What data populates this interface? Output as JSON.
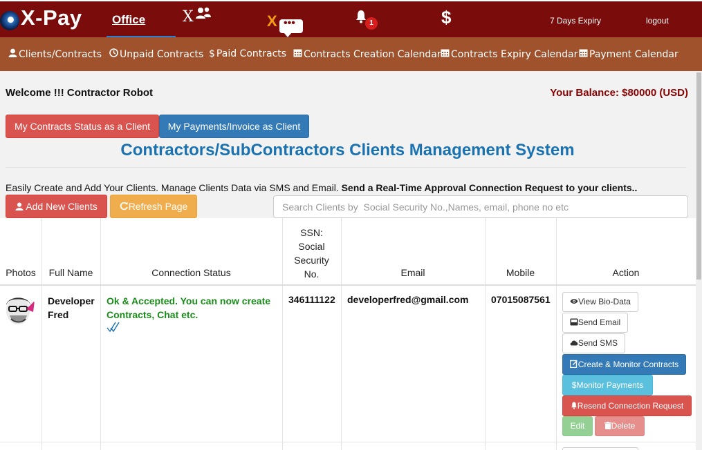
{
  "nav": {
    "logo": "X-Pay",
    "office": "Office",
    "users_x": "X",
    "chat_x": "X",
    "chat_glyph": "•••",
    "notifications_count": "1",
    "dollar": "$",
    "expiry": "7 Days Expiry",
    "logout": "logout"
  },
  "subnav": [
    "Clients/Contracts",
    "Unpaid Contracts",
    "Paid Contracts",
    "Contracts Creation Calendar",
    "Contracts Expiry Calendar",
    "Payment Calendar"
  ],
  "welcome": "Welcome !!! Contractor Robot",
  "balance": "Your Balance: $80000 (USD)",
  "buttons": {
    "status_as_client": "My Contracts Status as a Client",
    "payments_as_client": "My Payments/Invoice as Client",
    "add_clients": "Add New Clients",
    "refresh": "Refresh Page"
  },
  "system_title": "Contractors/SubContractors Clients Management System",
  "intro": {
    "normal": "Easily Create and Add Your Clients. Manage Clients Data via SMS and Email.",
    "bold": "Send a Real-Time Approval Connection Request to your clients.."
  },
  "search_placeholder": "Search Clients by  Social Security No.,Names, email, phone no etc",
  "table": {
    "headers": {
      "photos": "Photos",
      "full_name": "Full Name",
      "connection_status": "Connection Status",
      "ssn": [
        "SSN:",
        "Social",
        "Security",
        "No."
      ],
      "email": "Email",
      "mobile": "Mobile",
      "action": "Action"
    },
    "rows": [
      {
        "name_first": "Developer",
        "name_last": "Fred",
        "status_line1": "Ok & Accepted. You can now create",
        "status_line2": "Contracts, Chat etc.",
        "ssn": "346111122",
        "email": "developerfred@gmail.com",
        "mobile": "07015087561",
        "actions": {
          "view": "View Bio-Data",
          "email": "Send Email",
          "sms": "Send SMS",
          "contracts": "Create & Monitor Contracts",
          "payments": "Monitor Payments",
          "resend": "Resend Connection Request",
          "edit": "Edit",
          "delete": "Delete"
        }
      }
    ]
  },
  "colors": {
    "topbar": "#7a0d0b",
    "subbar": "#a0522d",
    "title_blue": "#1a72b0",
    "status_green": "#198c19",
    "balance_red": "#8b0000"
  }
}
